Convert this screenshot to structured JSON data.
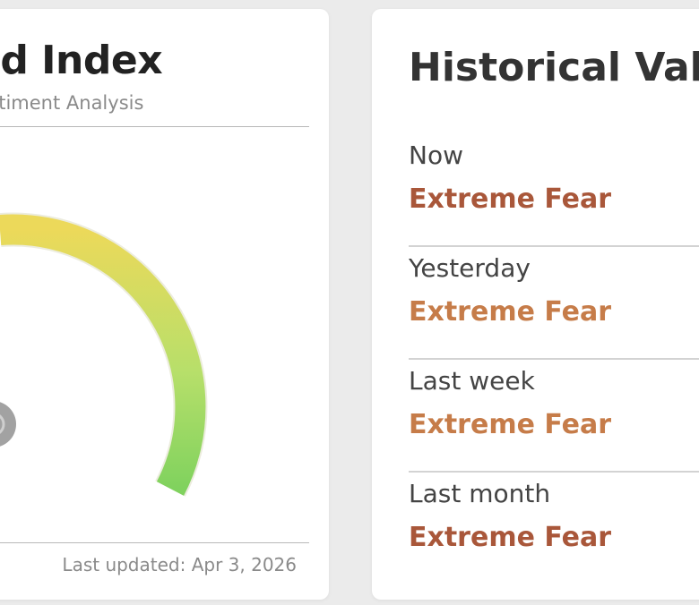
{
  "index_card": {
    "title": "ed Index",
    "subtitle": "entiment Analysis",
    "last_updated": "Last updated: Apr 3, 2026",
    "gauge": {
      "needle_icon": "gauge-pivot-icon",
      "colors": {
        "yellow": "#ecd95a",
        "green": "#80d25e",
        "pivot": "#9a9a9a"
      }
    }
  },
  "history_card": {
    "title": "Historical Valu",
    "rows": [
      {
        "label": "Now",
        "value": "Extreme Fear",
        "color": "#a9573a"
      },
      {
        "label": "Yesterday",
        "value": "Extreme Fear",
        "color": "#c67c49"
      },
      {
        "label": "Last week",
        "value": "Extreme Fear",
        "color": "#c67c49"
      },
      {
        "label": "Last month",
        "value": "Extreme Fear",
        "color": "#a9573a"
      }
    ]
  }
}
